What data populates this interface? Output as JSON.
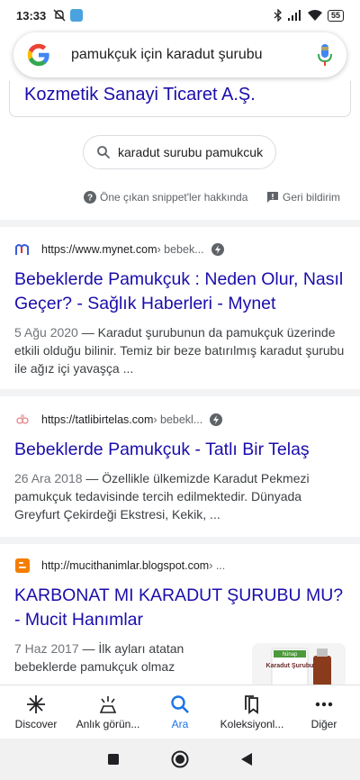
{
  "status": {
    "time": "13:33",
    "battery": "55",
    "icons": [
      "mute-icon",
      "app-badge-icon",
      "bluetooth-icon",
      "signal-icon",
      "wifi-icon"
    ]
  },
  "search": {
    "query": "pamukçuk için karadut şurubu"
  },
  "top_card": {
    "title": "Kozmetik Sanayi Ticaret A.Ş."
  },
  "related_chip": {
    "label": "karadut surubu pamukcuk"
  },
  "about": {
    "snippet_label": "Öne çıkan snippet'ler hakkında",
    "feedback_label": "Geri bildirim"
  },
  "results": [
    {
      "url": "https://www.mynet.com",
      "crumb": " › bebek...",
      "title": "Bebeklerde Pamukçuk : Neden Olur, Nasıl Geçer? - Sağlık Haberleri - Mynet",
      "date": "5 Ağu 2020",
      "snippet": " — Karadut şurubunun da pamukçuk üzerinde etkili olduğu bilinir. Temiz bir beze batırılmış karadut şurubu ile ağız içi yavaşça ..."
    },
    {
      "url": "https://tatlibirtelas.com",
      "crumb": " › bebekl...",
      "title": "Bebeklerde Pamukçuk - Tatlı Bir Telaş",
      "date": "26 Ara 2018",
      "snippet": " — Özellikle ülkemizde Karadut Pekmezi pamukçuk tedavisinde tercih edilmektedir. Dünyada Greyfurt Çekirdeği Ekstresi, Kekik, ..."
    },
    {
      "url": "http://mucithanimlar.blogspot.com",
      "crumb": " › ...",
      "title": "KARBONAT MI KARADUT ŞURUBU MU? - Mucit Hanımlar",
      "date": "7 Haz 2017",
      "snippet": " — İlk ayları atatan bebeklerde pamukçuk olmaz"
    }
  ],
  "thumbnail": {
    "brand": "hünap",
    "product": "Karadut Şurubu"
  },
  "bottom_nav": [
    {
      "label": "Discover",
      "icon": "asterisk-icon"
    },
    {
      "label": "Anlık görün...",
      "icon": "updates-icon"
    },
    {
      "label": "Ara",
      "icon": "search-icon"
    },
    {
      "label": "Koleksiyonl...",
      "icon": "collections-icon"
    },
    {
      "label": "Diğer",
      "icon": "more-icon"
    }
  ],
  "colors": {
    "link": "#1a0dab",
    "active": "#1a73e8",
    "separator": "#f1f3f4"
  }
}
